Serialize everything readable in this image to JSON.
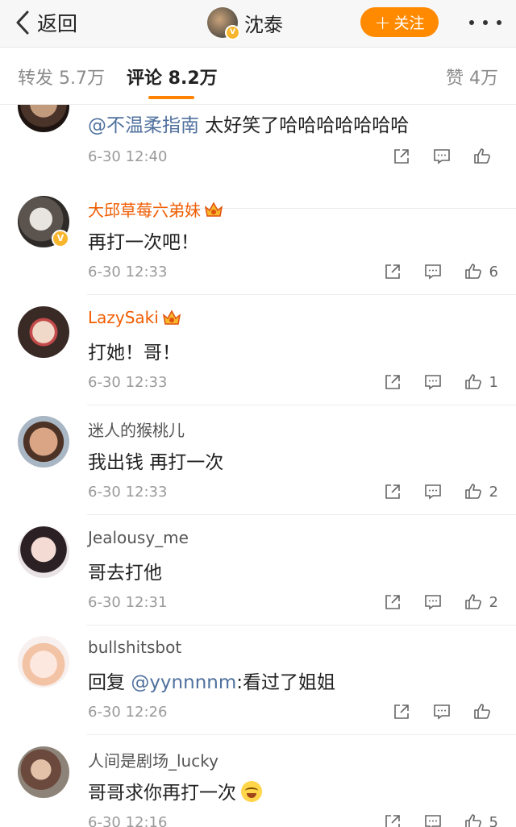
{
  "nav": {
    "back_label": "返回",
    "title": "沈泰",
    "follow_label": "关注"
  },
  "tabs": {
    "repost": "转发 5.7万",
    "comment": "评论 8.2万",
    "like": "赞 4万"
  },
  "colors": {
    "accent": "#ff8200",
    "vip_name": "#f15c00",
    "mention": "#50719e"
  },
  "comments": [
    {
      "username": "",
      "text_mention": "@不温柔指南",
      "text": " 太好笑了哈哈哈哈哈哈哈",
      "time": "6-30 12:40",
      "likes": ""
    },
    {
      "username": "大邱草莓六弟妹",
      "vip": true,
      "text": "再打一次吧！",
      "time": "6-30 12:33",
      "likes": "6"
    },
    {
      "username": "LazySaki",
      "vip": true,
      "text": "打她！哥！",
      "time": "6-30 12:33",
      "likes": "1"
    },
    {
      "username": "迷人的猴桃儿",
      "text": "我出钱 再打一次",
      "time": "6-30 12:33",
      "likes": "2"
    },
    {
      "username": "Jealousy_me",
      "text": "哥去打他",
      "time": "6-30 12:31",
      "likes": "2"
    },
    {
      "username": "bullshitsbot",
      "text_prefix": "回复 ",
      "text_mention": "@yynnnnm",
      "text": ":看过了姐姐",
      "time": "6-30 12:26",
      "likes": ""
    },
    {
      "username": "人间是剧场_lucky",
      "text": "哥哥求你再打一次",
      "emoji": "laughing-crying",
      "time": "6-30 12:16",
      "likes": "5"
    }
  ]
}
